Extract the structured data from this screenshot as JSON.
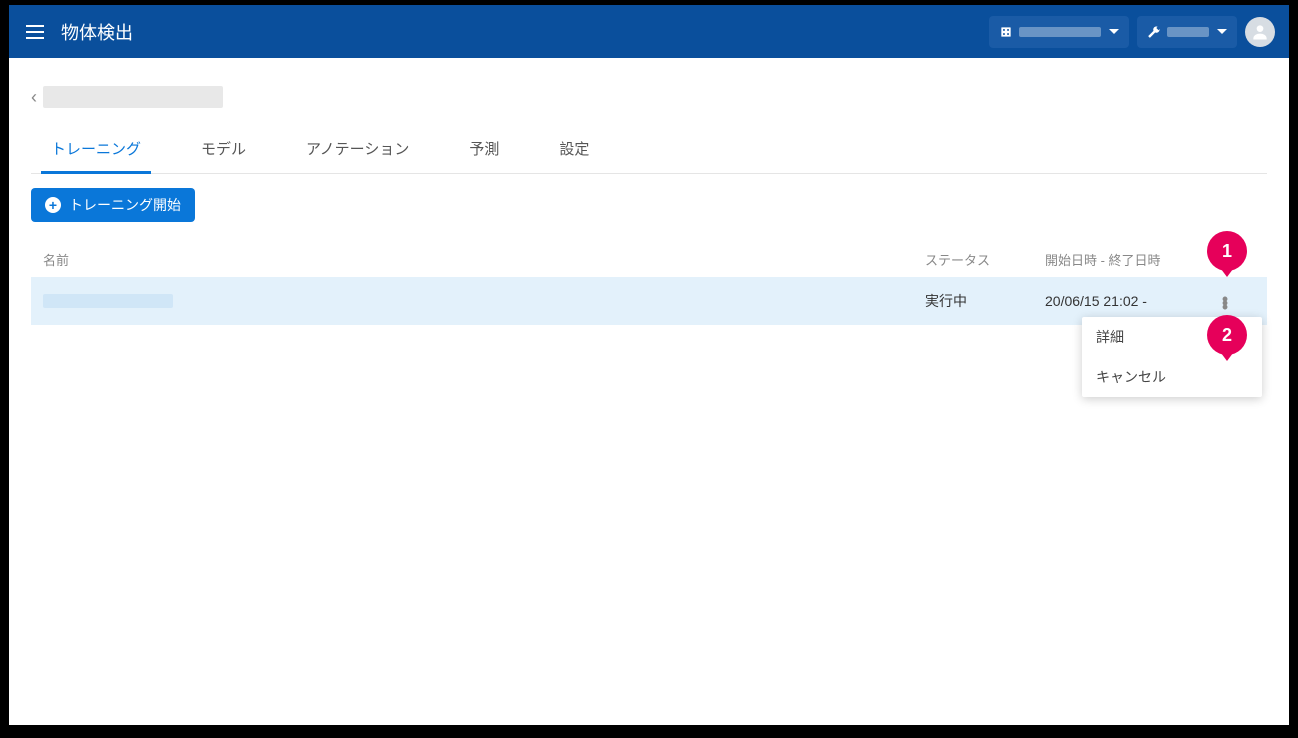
{
  "header": {
    "title": "物体検出"
  },
  "tabs": [
    {
      "id": "training",
      "label": "トレーニング",
      "active": true
    },
    {
      "id": "model",
      "label": "モデル",
      "active": false
    },
    {
      "id": "annotation",
      "label": "アノテーション",
      "active": false
    },
    {
      "id": "predict",
      "label": "予測",
      "active": false
    },
    {
      "id": "settings",
      "label": "設定",
      "active": false
    }
  ],
  "actions": {
    "start_training": "トレーニング開始"
  },
  "table": {
    "columns": {
      "name": "名前",
      "status": "ステータス",
      "time": "開始日時 - 終了日時"
    },
    "rows": [
      {
        "name": "",
        "status": "実行中",
        "time": "20/06/15 21:02 -"
      }
    ]
  },
  "menu": {
    "detail": "詳細",
    "cancel": "キャンセル"
  },
  "callouts": {
    "one": "1",
    "two": "2"
  }
}
